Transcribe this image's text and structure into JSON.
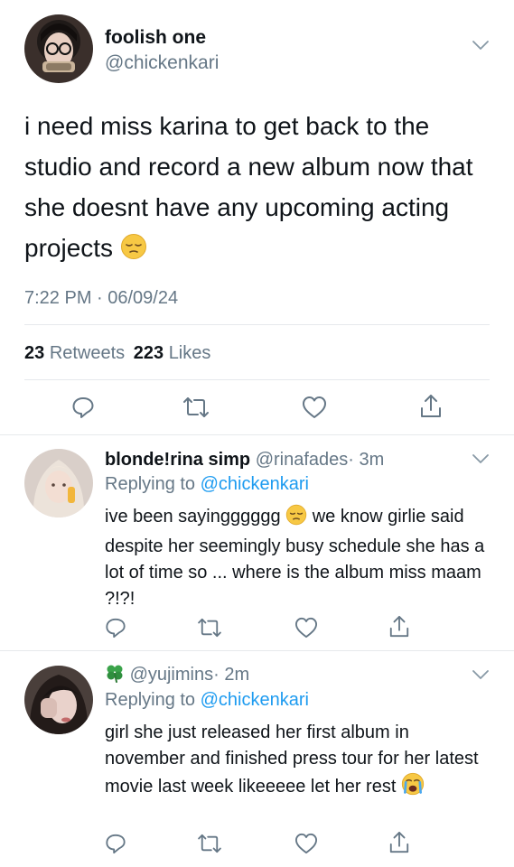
{
  "main_tweet": {
    "display_name": "foolish one",
    "handle": "@chickenkari",
    "text": "i need miss karina to get back to the studio and record a new album now that she doesnt have any upcoming acting projects",
    "timestamp": "7:22 PM · 06/09/24",
    "retweets_count": "23",
    "retweets_label": "Retweets",
    "likes_count": "223",
    "likes_label": "Likes"
  },
  "replies": [
    {
      "display_name": "blonde!rina simp",
      "handle": "@rinafades",
      "time": "· 3m",
      "replying_prefix": "Replying to",
      "replying_handle": "@chickenkari",
      "text_before_emoji": "ive been sayingggggg",
      "text_after_emoji": "we know girlie said despite her seemingly busy schedule she has a lot of time so ... where is the album miss maam ?!?!"
    },
    {
      "display_name": "",
      "handle": "@yujimins",
      "time": "· 2m",
      "replying_prefix": "Replying to",
      "replying_handle": "@chickenkari",
      "text": "girl she just released her first album in november and finished press tour for her latest movie last week likeeeee let her rest"
    }
  ],
  "colors": {
    "link": "#1d9bf0",
    "muted": "#657786",
    "text": "#0f1419",
    "divider": "#e6e9ec"
  },
  "icons": [
    "chevron-down-icon",
    "reply-icon",
    "retweet-icon",
    "like-icon",
    "share-icon",
    "pensive-emoji",
    "clover-emoji",
    "crying-emoji"
  ]
}
